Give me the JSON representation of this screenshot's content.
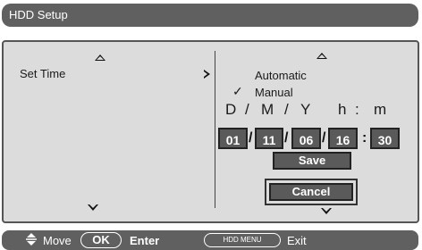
{
  "header": {
    "title": "HDD Setup"
  },
  "left": {
    "item_label": "Set Time"
  },
  "right": {
    "options": {
      "automatic": "Automatic",
      "manual": "Manual",
      "check_mark": "✓"
    },
    "format": {
      "d": "D",
      "s1": "/",
      "m": "M",
      "s2": "/",
      "y": "Y",
      "h": "h",
      "colon": ":",
      "min": "m"
    },
    "values": {
      "day": "01",
      "month": "11",
      "year": "06",
      "hour": "16",
      "minute": "30"
    },
    "separators": {
      "slash": "/",
      "colon": ":"
    },
    "save_label": "Save",
    "cancel_label": "Cancel"
  },
  "footer": {
    "move": "Move",
    "ok": "OK",
    "enter": "Enter",
    "menu": "HDD MENU",
    "exit": "Exit"
  }
}
